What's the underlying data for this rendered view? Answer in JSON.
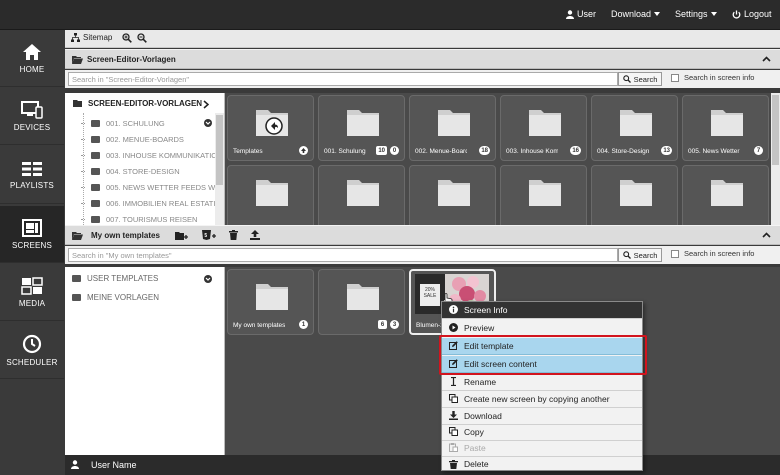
{
  "topbar": {
    "user": "User",
    "download": "Download",
    "settings": "Settings",
    "logout": "Logout"
  },
  "nav": [
    {
      "label": "HOME",
      "icon": "home-icon"
    },
    {
      "label": "DEVICES",
      "icon": "devices-icon"
    },
    {
      "label": "PLAYLISTS",
      "icon": "playlists-icon"
    },
    {
      "label": "SCREENS",
      "icon": "screens-icon"
    },
    {
      "label": "MEDIA",
      "icon": "media-icon"
    },
    {
      "label": "SCHEDULER",
      "icon": "clock-icon"
    }
  ],
  "toolbar": {
    "sitemap": "Sitemap"
  },
  "section1": {
    "title": "Screen-Editor-Vorlagen",
    "search_placeholder": "Search in \"Screen-Editor-Vorlagen\"",
    "search_button": "Search",
    "search_checkbox": "Search in screen info",
    "tree_root": "SCREEN-EDITOR-VORLAGEN",
    "tree_items": [
      "001. SCHULUNG",
      "002. MENUE-BOARDS",
      "003. INHOUSE KOMMUNIKATIO",
      "004. STORE-DESIGN",
      "005. NEWS WETTER FEEDS WE",
      "006. IMMOBILIEN REAL ESTATI",
      "007. TOURISMUS REISEN"
    ],
    "tiles": [
      {
        "label": "Templates",
        "badge": "",
        "badge2": ""
      },
      {
        "label": "001. Schulung",
        "badge": "10",
        "badge2": "0"
      },
      {
        "label": "002. Menue-Boards",
        "badge": "",
        "badge2": "18"
      },
      {
        "label": "003. Inhouse Komm...",
        "badge": "",
        "badge2": "16"
      },
      {
        "label": "004. Store-Design",
        "badge": "",
        "badge2": "13"
      },
      {
        "label": "005. News Wetter F...",
        "badge": "",
        "badge2": "7"
      }
    ]
  },
  "section2": {
    "title": "My own templates",
    "search_placeholder": "Search in \"My own templates\"",
    "search_button": "Search",
    "search_checkbox": "Search in screen info",
    "tree_items": [
      "USER TEMPLATES",
      "MEINE VORLAGEN"
    ],
    "tiles": [
      {
        "label": "My own templates",
        "badge": "1",
        "badge2": ""
      },
      {
        "label": "",
        "badge": "6",
        "badge2": "3"
      },
      {
        "label": "Blumen-2...",
        "thumb_text_1": "20%",
        "thumb_text_2": "SALE"
      }
    ]
  },
  "context_menu": {
    "header": "Screen Info",
    "items": [
      {
        "label": "Preview",
        "icon": "play-circle-icon",
        "state": "normal"
      },
      {
        "label": "Edit template",
        "icon": "edit-icon",
        "state": "highlighted"
      },
      {
        "label": "Edit screen content",
        "icon": "edit-icon",
        "state": "highlighted"
      },
      {
        "label": "Rename",
        "icon": "text-cursor-icon",
        "state": "normal"
      },
      {
        "label": "Create new screen by copying another",
        "icon": "copy-icon",
        "state": "normal"
      },
      {
        "label": "Download",
        "icon": "download-icon",
        "state": "normal"
      },
      {
        "label": "Copy",
        "icon": "copy-icon",
        "state": "normal"
      },
      {
        "label": "Paste",
        "icon": "paste-icon",
        "state": "disabled"
      },
      {
        "label": "Delete",
        "icon": "trash-icon",
        "state": "normal"
      }
    ]
  },
  "footer": {
    "user_name": "User Name"
  },
  "colors": {
    "highlight": "#a9d6ee",
    "annotation_red": "#d2141e",
    "dark_bg": "#2b2b2b"
  }
}
